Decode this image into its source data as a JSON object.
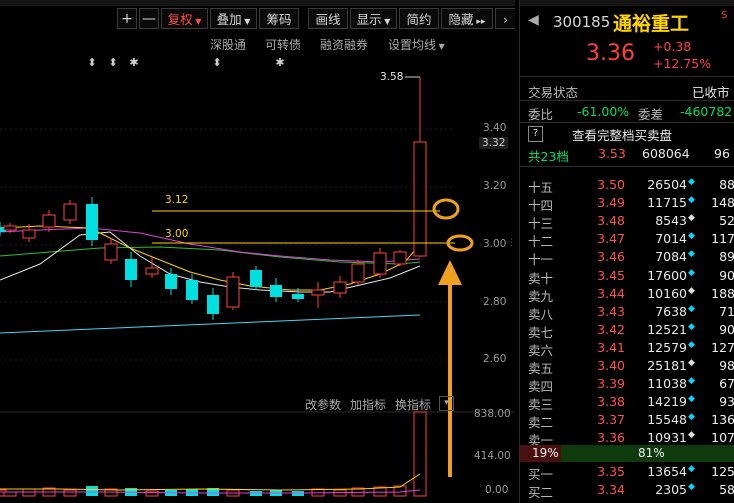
{
  "toolbar": {
    "plus": "+",
    "minus": "—",
    "buttons": [
      "复权",
      "叠加",
      "筹码",
      "画线",
      "显示",
      "简约",
      "隐藏"
    ]
  },
  "subtoolbar": [
    "深股通",
    "可转债",
    "融资融券",
    "设置均线"
  ],
  "chart": {
    "y_ticks": [
      "3.40",
      "3.20",
      "3.00",
      "2.80",
      "2.60"
    ],
    "price_box": "3.32",
    "high_label": "3.58",
    "line_labels": [
      "3.12",
      "3.00"
    ],
    "indicator_tabs": [
      "改参数",
      "加指标",
      "换指标"
    ],
    "vol_ticks": [
      "838.00",
      "414.00",
      "0.00"
    ],
    "markers": [
      "⬍",
      "⬍",
      "✱",
      "⬍",
      "✱"
    ]
  },
  "chart_data": {
    "type": "candlestick",
    "y_range": [
      2.55,
      3.6
    ],
    "hlines": [
      3.12,
      3.0
    ],
    "last_close": 3.36,
    "high": 3.58
  },
  "quote": {
    "code": "300185",
    "name": "通裕重工",
    "tag": "S",
    "price": "3.36",
    "change": "+0.38",
    "pct": "+12.75%",
    "status_label": "交易状态",
    "status_value": "已收市",
    "weibi_label": "委比",
    "weibi_value": "-61.00%",
    "weicha_label": "委差",
    "weicha_value": "-460782",
    "full_book": "查看完整档买卖盘",
    "levels_label": "共23档",
    "levels_price": "3.53",
    "levels_vol": "608064",
    "levels_ord": "96"
  },
  "asks": [
    {
      "lbl": "十五",
      "price": "3.50",
      "vol": "26504",
      "ord": "88"
    },
    {
      "lbl": "十四",
      "price": "3.49",
      "vol": "11715",
      "ord": "148"
    },
    {
      "lbl": "十三",
      "price": "3.48",
      "vol": "8543",
      "ord": "52"
    },
    {
      "lbl": "十二",
      "price": "3.47",
      "vol": "7014",
      "ord": "117"
    },
    {
      "lbl": "十一",
      "price": "3.46",
      "vol": "7084",
      "ord": "89"
    },
    {
      "lbl": "卖十",
      "price": "3.45",
      "vol": "17600",
      "ord": "90"
    },
    {
      "lbl": "卖九",
      "price": "3.44",
      "vol": "10160",
      "ord": "188"
    },
    {
      "lbl": "卖八",
      "price": "3.43",
      "vol": "7638",
      "ord": "71"
    },
    {
      "lbl": "卖七",
      "price": "3.42",
      "vol": "12521",
      "ord": "90"
    },
    {
      "lbl": "卖六",
      "price": "3.41",
      "vol": "12579",
      "ord": "127"
    },
    {
      "lbl": "卖五",
      "price": "3.40",
      "vol": "25181",
      "ord": "98"
    },
    {
      "lbl": "卖四",
      "price": "3.39",
      "vol": "11038",
      "ord": "67"
    },
    {
      "lbl": "卖三",
      "price": "3.38",
      "vol": "14219",
      "ord": "93"
    },
    {
      "lbl": "卖二",
      "price": "3.37",
      "vol": "15548",
      "ord": "136"
    },
    {
      "lbl": "卖一",
      "price": "3.36",
      "vol": "10931",
      "ord": "107"
    }
  ],
  "ratio": {
    "left": "19%",
    "right": "81%",
    "left_pct": 19,
    "right_pct": 81
  },
  "bids": [
    {
      "lbl": "买一",
      "price": "3.35",
      "vol": "13654",
      "ord": "125"
    },
    {
      "lbl": "买二",
      "price": "3.34",
      "vol": "2305",
      "ord": "58"
    }
  ],
  "colors": {
    "up": "#ff4040",
    "down": "#00e0e0",
    "yellow": "#ffd400",
    "accent": "#f0a020"
  }
}
